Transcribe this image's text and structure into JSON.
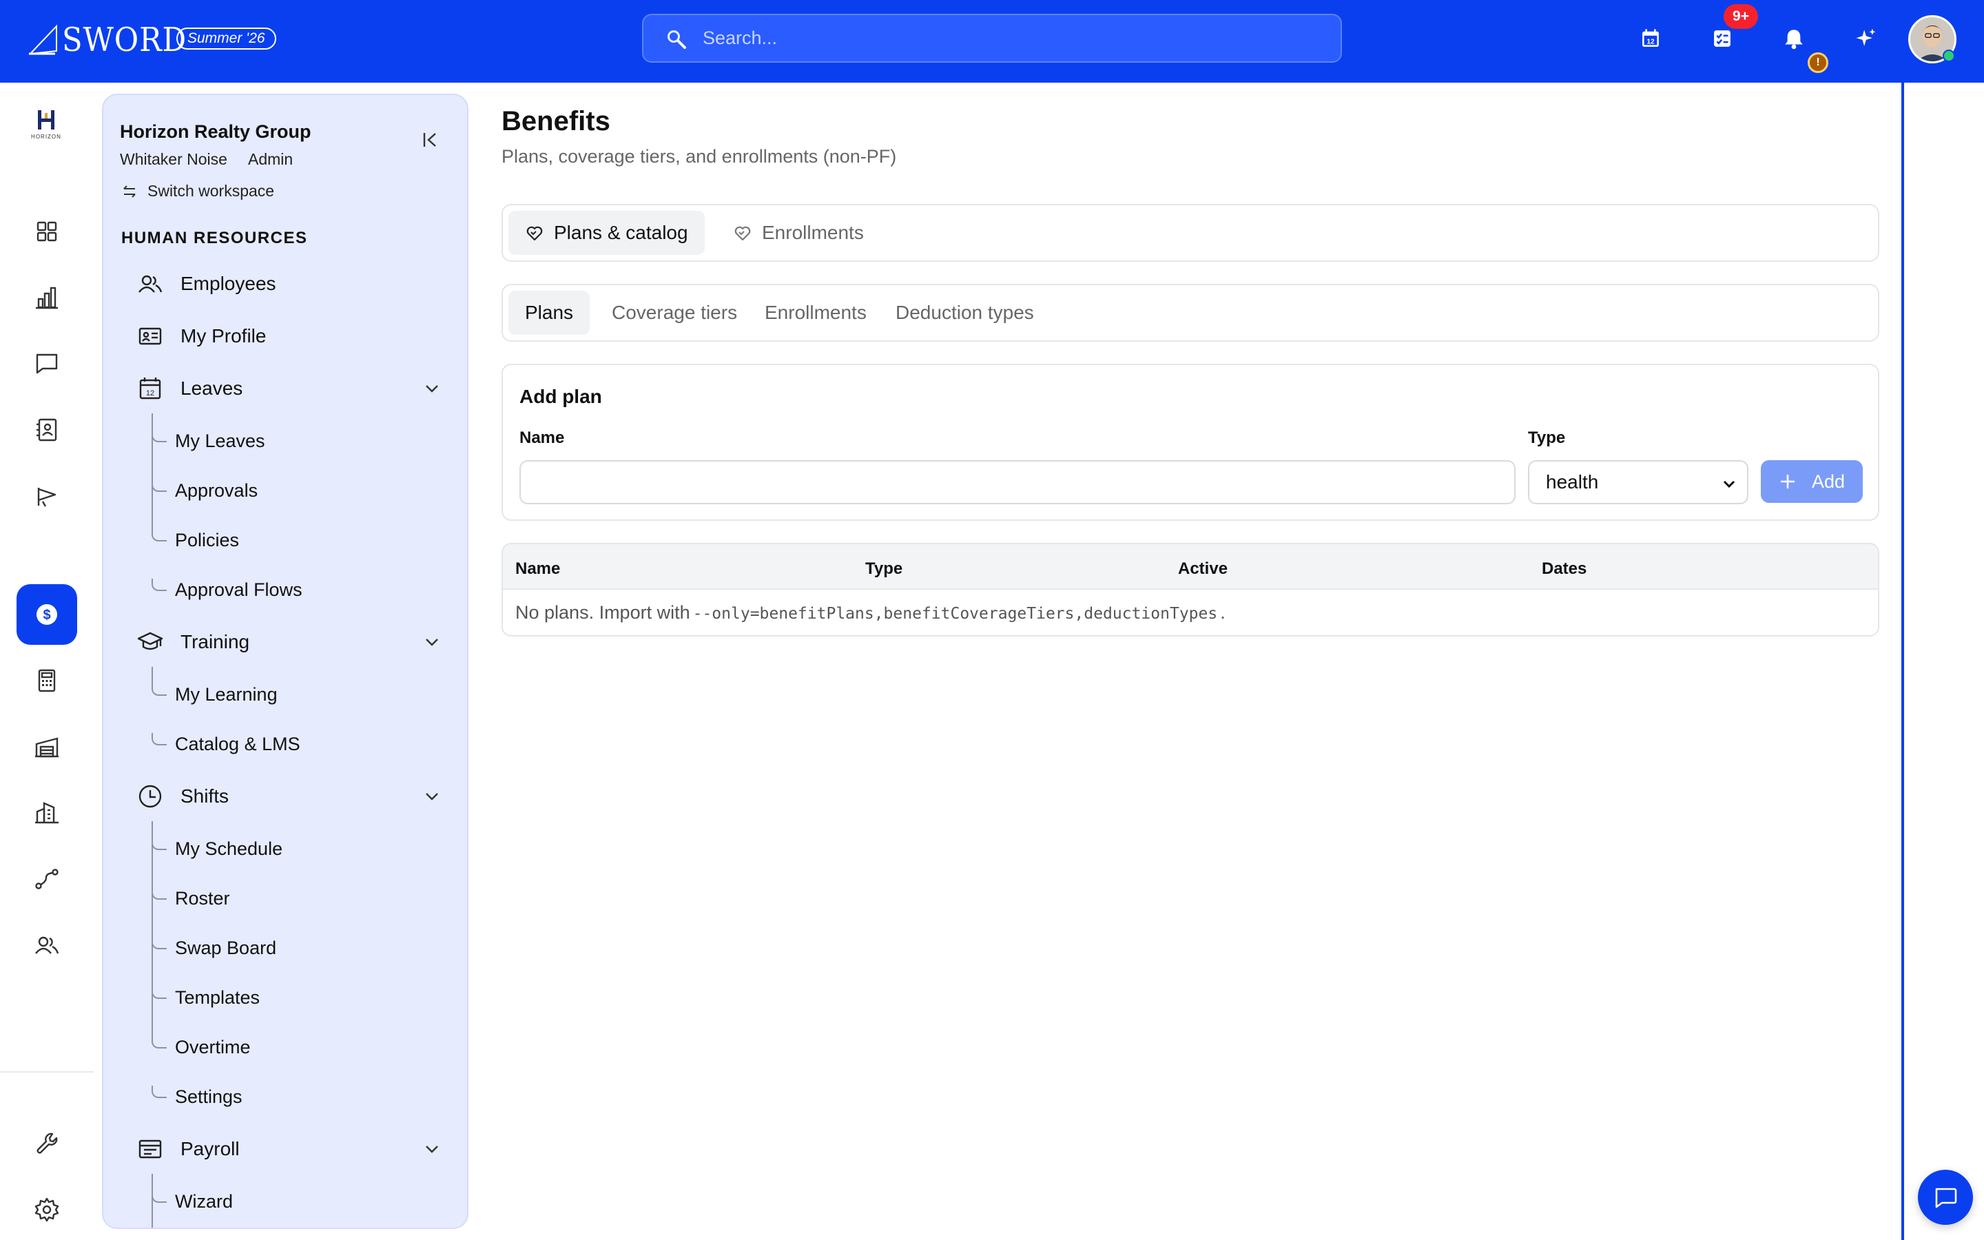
{
  "brand": {
    "name": "SWORD",
    "release": "Summer '26"
  },
  "search": {
    "placeholder": "Search..."
  },
  "topbar": {
    "calendar_icon": "calendar-12-icon",
    "tasks_badge": "9+",
    "bell_icon": "bell-icon",
    "ai_icon": "sparkle-icon",
    "bell_alert": "!"
  },
  "rail": {
    "logo_text": "HORIZON",
    "items": [
      "dashboard-grid-icon",
      "bar-chart-icon",
      "chat-icon",
      "contacts-icon",
      "campaign-flag-icon",
      "dollar-icon",
      "calculator-icon",
      "warehouse-icon",
      "building-icon",
      "route-icon",
      "people-icon"
    ],
    "bottom": [
      "wrench-icon",
      "gear-icon"
    ]
  },
  "sidebar": {
    "org": "Horizon Realty Group",
    "user": "Whitaker Noise",
    "role": "Admin",
    "switch": "Switch workspace",
    "section": "HUMAN RESOURCES",
    "employees": "Employees",
    "my_profile": "My Profile",
    "leaves": "Leaves",
    "leaves_items": [
      "My Leaves",
      "Approvals",
      "Policies",
      "Approval Flows"
    ],
    "training": "Training",
    "training_items": [
      "My Learning",
      "Catalog & LMS"
    ],
    "shifts": "Shifts",
    "shifts_items": [
      "My Schedule",
      "Roster",
      "Swap Board",
      "Templates",
      "Overtime",
      "Settings"
    ],
    "payroll": "Payroll",
    "payroll_items": [
      "Wizard"
    ]
  },
  "main": {
    "title": "Benefits",
    "subtitle": "Plans, coverage tiers, and enrollments (non-PF)",
    "top_tabs": [
      "Plans & catalog",
      "Enrollments"
    ],
    "sub_tabs": [
      "Plans",
      "Coverage tiers",
      "Enrollments",
      "Deduction types"
    ],
    "add_plan": {
      "title": "Add plan",
      "name_label": "Name",
      "name_value": "",
      "type_label": "Type",
      "type_value": "health",
      "add_label": "Add"
    },
    "table": {
      "headers": [
        "Name",
        "Type",
        "Active",
        "Dates"
      ],
      "empty_prefix": "No plans. Import with",
      "empty_code": "--only=benefitPlans,benefitCoverageTiers,deductionTypes",
      "empty_suffix": "."
    }
  },
  "colors": {
    "brand_blue": "#0a3ff0",
    "sidebar_bg": "#e6ebfd",
    "badge_red": "#f5222d"
  }
}
